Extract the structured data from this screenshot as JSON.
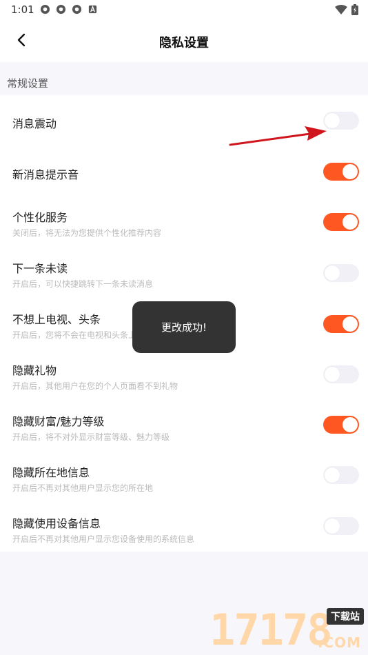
{
  "status_bar": {
    "time": "1:01"
  },
  "header": {
    "title": "隐私设置"
  },
  "section": {
    "label": "常规设置"
  },
  "settings": [
    {
      "title": "消息震动",
      "subtitle": "",
      "on": false
    },
    {
      "title": "新消息提示音",
      "subtitle": "",
      "on": true
    },
    {
      "title": "个性化服务",
      "subtitle": "关闭后，将无法为您提供个性化推荐内容",
      "on": true
    },
    {
      "title": "下一条未读",
      "subtitle": "开启后，可以快捷跳转下一条未读消息",
      "on": false
    },
    {
      "title": "不想上电视、头条",
      "subtitle": "开启后，您将不会在电视和头条上",
      "on": true
    },
    {
      "title": "隐藏礼物",
      "subtitle": "开启后，其他用户在您的个人页面看不到礼物",
      "on": false
    },
    {
      "title": "隐藏财富/魅力等级",
      "subtitle": "开启后，将不对外显示财富等级、魅力等级",
      "on": true
    },
    {
      "title": "隐藏所在地信息",
      "subtitle": "开启后不再对其他用户显示您的所在地",
      "on": false
    },
    {
      "title": "隐藏使用设备信息",
      "subtitle": "开启后不再对其他用户显示您设备使用的系统信息",
      "on": false
    }
  ],
  "toast": {
    "message": "更改成功!"
  },
  "watermark": {
    "number": "17178",
    "tag": "下载站",
    "suffix": ".COM"
  },
  "colors": {
    "accent": "#ff5722",
    "toggle_off": "#f0f0f6"
  }
}
